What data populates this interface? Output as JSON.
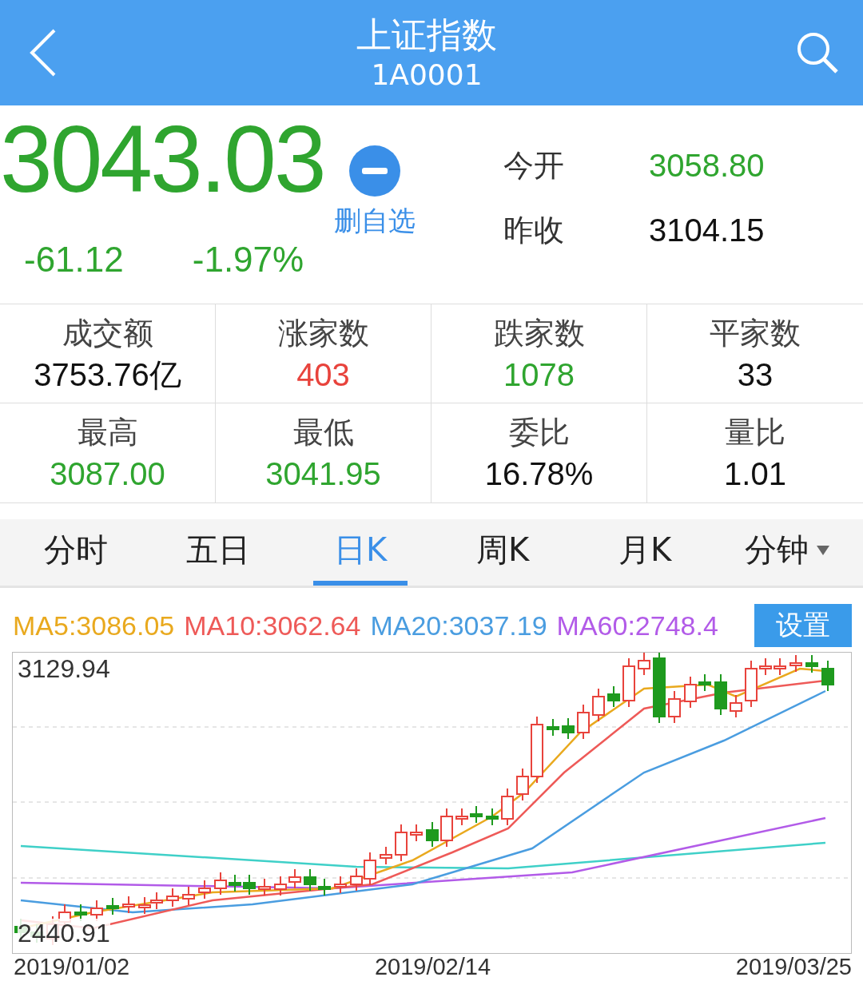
{
  "header": {
    "title": "上证指数",
    "code": "1A0001"
  },
  "quote": {
    "price": "3043.03",
    "color": "#2fa52f",
    "change": "-61.12",
    "change_pct": "-1.97%",
    "watchlist_label": "删自选"
  },
  "side": [
    {
      "label": "今开",
      "value": "3058.80",
      "color": "#2fa52f"
    },
    {
      "label": "昨收",
      "value": "3104.15",
      "color": "#111111"
    }
  ],
  "stats": [
    {
      "label": "成交额",
      "value": "3753.76亿",
      "color": "#111111"
    },
    {
      "label": "涨家数",
      "value": "403",
      "color": "#e8433c"
    },
    {
      "label": "跌家数",
      "value": "1078",
      "color": "#2fa52f"
    },
    {
      "label": "平家数",
      "value": "33",
      "color": "#111111"
    },
    {
      "label": "最高",
      "value": "3087.00",
      "color": "#2fa52f"
    },
    {
      "label": "最低",
      "value": "3041.95",
      "color": "#2fa52f"
    },
    {
      "label": "委比",
      "value": "16.78%",
      "color": "#111111"
    },
    {
      "label": "量比",
      "value": "1.01",
      "color": "#111111"
    }
  ],
  "tabs": [
    {
      "label": "分时",
      "selected": false,
      "menu": false
    },
    {
      "label": "五日",
      "selected": false,
      "menu": false
    },
    {
      "label": "日K",
      "selected": true,
      "menu": false
    },
    {
      "label": "周K",
      "selected": false,
      "menu": false
    },
    {
      "label": "月K",
      "selected": false,
      "menu": false
    },
    {
      "label": "分钟",
      "selected": false,
      "menu": true
    }
  ],
  "indicators": [
    {
      "label": "MA5:3086.05",
      "color": "#e9a91e"
    },
    {
      "label": "MA10:3062.64",
      "color": "#ee5a58"
    },
    {
      "label": "MA20:3037.19",
      "color": "#4a9de0"
    },
    {
      "label": "MA60:2748.4",
      "color": "#b25be8"
    }
  ],
  "settings_button": "设置",
  "chart": {
    "y_max_label": "3129.94",
    "y_min_label": "2440.91",
    "dates": [
      "2019/01/02",
      "2019/02/14",
      "2019/03/25"
    ]
  }
}
